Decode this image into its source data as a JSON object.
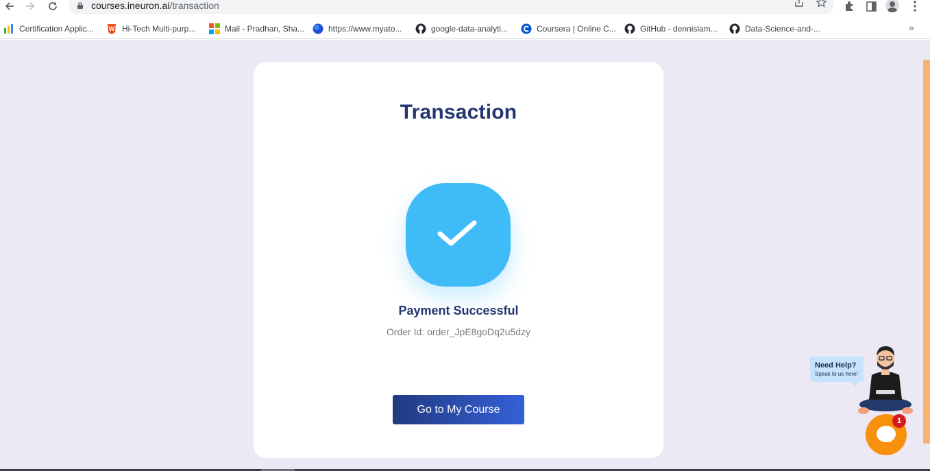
{
  "browser": {
    "url_domain": "courses.ineuron.ai",
    "url_path": "/transaction",
    "back_icon": "arrow-left-icon",
    "forward_icon": "arrow-right-icon",
    "reload_icon": "reload-icon",
    "more_bookmarks_glyph": "»"
  },
  "bookmarks": [
    {
      "label": "Certification Applic...",
      "icon": "bar-chart-favicon"
    },
    {
      "label": "Hi-Tech Multi-purp...",
      "icon": "w-favicon"
    },
    {
      "label": "Mail - Pradhan, Sha...",
      "icon": "microsoft-favicon"
    },
    {
      "label": "https://www.myato...",
      "icon": "blue-circle-favicon"
    },
    {
      "label": "google-data-analyti...",
      "icon": "github-favicon"
    },
    {
      "label": "Coursera | Online C...",
      "icon": "coursera-favicon"
    },
    {
      "label": "GitHub - dennislam...",
      "icon": "github-favicon"
    },
    {
      "label": "Data-Science-and-...",
      "icon": "github-favicon"
    }
  ],
  "card": {
    "title": "Transaction",
    "status": "Payment Successful",
    "order_id": "Order Id: order_JpE8goDq2u5dzy",
    "button_label": "Go to My Course"
  },
  "help": {
    "title": "Need Help?",
    "subtitle": "Speak to us here!",
    "badge_count": "1"
  },
  "colors": {
    "page_bg": "#ece9f5",
    "title": "#233670",
    "check": "#3fbcf8",
    "button_start": "#233a80",
    "button_end": "#3460d8",
    "chat": "#f7900d"
  }
}
